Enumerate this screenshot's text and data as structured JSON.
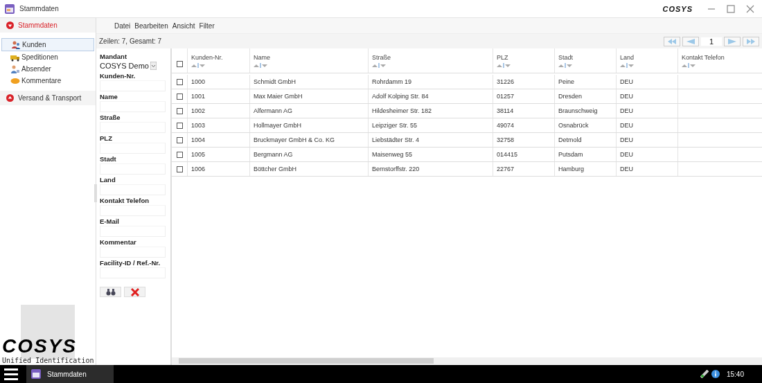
{
  "window": {
    "title": "Stammdaten",
    "logo": "COSYS"
  },
  "sidebar": {
    "groups": [
      {
        "label": "Stammdaten",
        "expanded": true,
        "items": [
          {
            "label": "Kunden",
            "selected": true
          },
          {
            "label": "Speditionen",
            "selected": false
          },
          {
            "label": "Absender",
            "selected": false
          },
          {
            "label": "Kommentare",
            "selected": false
          }
        ]
      },
      {
        "label": "Versand & Transport",
        "expanded": false
      }
    ],
    "logo": {
      "brand": "COSYS",
      "tagline": "Unified Identification"
    }
  },
  "menu": [
    "Datei",
    "Bearbeiten",
    "Ansicht",
    "Filter"
  ],
  "summary": "Zeilen: 7, Gesamt: 7",
  "pager": {
    "page": "1"
  },
  "filter": {
    "mandant_label": "Mandant",
    "mandant_value": "COSYS Demo",
    "fields": [
      "Kunden-Nr.",
      "Name",
      "Straße",
      "PLZ",
      "Stadt",
      "Land",
      "Kontakt Telefon",
      "E-Mail",
      "Kommentar",
      "Facility-ID / Ref.-Nr."
    ]
  },
  "table": {
    "header_checked": false,
    "columns": [
      "Kunden-Nr.",
      "Name",
      "Straße",
      "PLZ",
      "Stadt",
      "Land",
      "Kontakt Telefon"
    ],
    "rows": [
      {
        "checked": false,
        "cells": [
          "1000",
          "Schmidt GmbH",
          "Rohrdamm 19",
          "31226",
          "Peine",
          "DEU",
          ""
        ]
      },
      {
        "checked": false,
        "cells": [
          "1001",
          "Max Maier GmbH",
          "Adolf Kolping Str. 84",
          "01257",
          "Dresden",
          "DEU",
          ""
        ]
      },
      {
        "checked": false,
        "cells": [
          "1002",
          "Alfermann AG",
          "Hildesheimer Str. 182",
          "38114",
          "Braunschweig",
          "DEU",
          ""
        ]
      },
      {
        "checked": false,
        "cells": [
          "1003",
          "Hollmayer GmbH",
          "Leipziger Str. 55",
          "49074",
          "Osnabrück",
          "DEU",
          ""
        ]
      },
      {
        "checked": false,
        "cells": [
          "1004",
          "Bruckmayer GmbH & Co. KG",
          "Liebstädter Str. 4",
          "32758",
          "Detmold",
          "DEU",
          ""
        ]
      },
      {
        "checked": false,
        "cells": [
          "1005",
          "Bergmann AG",
          "Maisenweg 55",
          "014415",
          "Putsdam",
          "DEU",
          ""
        ]
      },
      {
        "checked": false,
        "cells": [
          "1006",
          "Böttcher GmbH",
          "Bernstorffstr. 220",
          "22767",
          "Hamburg",
          "DEU",
          ""
        ]
      }
    ]
  },
  "taskbar": {
    "task": "Stammdaten",
    "time": "15:40"
  }
}
